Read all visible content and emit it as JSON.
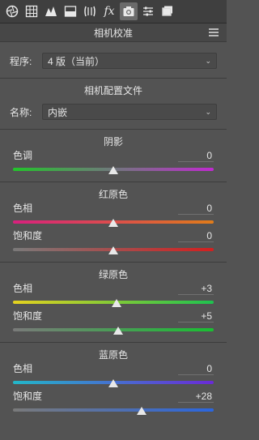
{
  "toolbar": {
    "icons": [
      "aperture-icon",
      "histogram-grid-icon",
      "tone-curve-icon",
      "split-tone-icon",
      "lens-icon",
      "fx-icon",
      "camera-icon",
      "sliders-icon",
      "presets-icon"
    ],
    "fx_label": "fx",
    "active": "camera-icon"
  },
  "panel": {
    "title": "相机校准",
    "menu_icon": "panel-menu-icon"
  },
  "process": {
    "label": "程序:",
    "value": "4 版（当前）"
  },
  "profile": {
    "section_title": "相机配置文件",
    "label": "名称:",
    "value": "内嵌"
  },
  "shadows": {
    "title": "阴影",
    "tint": {
      "label": "色调",
      "value": "0",
      "level": 0.5
    }
  },
  "red": {
    "title": "红原色",
    "hue": {
      "label": "色相",
      "value": "0",
      "level": 0.5
    },
    "saturation": {
      "label": "饱和度",
      "value": "0",
      "level": 0.5
    }
  },
  "green": {
    "title": "绿原色",
    "hue": {
      "label": "色相",
      "value": "+3",
      "level": 0.515
    },
    "saturation": {
      "label": "饱和度",
      "value": "+5",
      "level": 0.525
    }
  },
  "blue": {
    "title": "蓝原色",
    "hue": {
      "label": "色相",
      "value": "0",
      "level": 0.5
    },
    "saturation": {
      "label": "饱和度",
      "value": "+28",
      "level": 0.64
    }
  },
  "colors": {
    "tint": [
      "#22c52a",
      "#c02ad0"
    ],
    "red_hue": [
      "#d8207e",
      "#e07c1a"
    ],
    "red_sat": [
      "#7a7a7a",
      "#d41f1f"
    ],
    "green_hue": [
      "#e6d21f",
      "#1ec24f"
    ],
    "green_sat": [
      "#7a7a7a",
      "#19c032"
    ],
    "blue_hue": [
      "#22b7c9",
      "#6a2ad6"
    ],
    "blue_sat": [
      "#7a7a7a",
      "#2a66e0"
    ]
  }
}
